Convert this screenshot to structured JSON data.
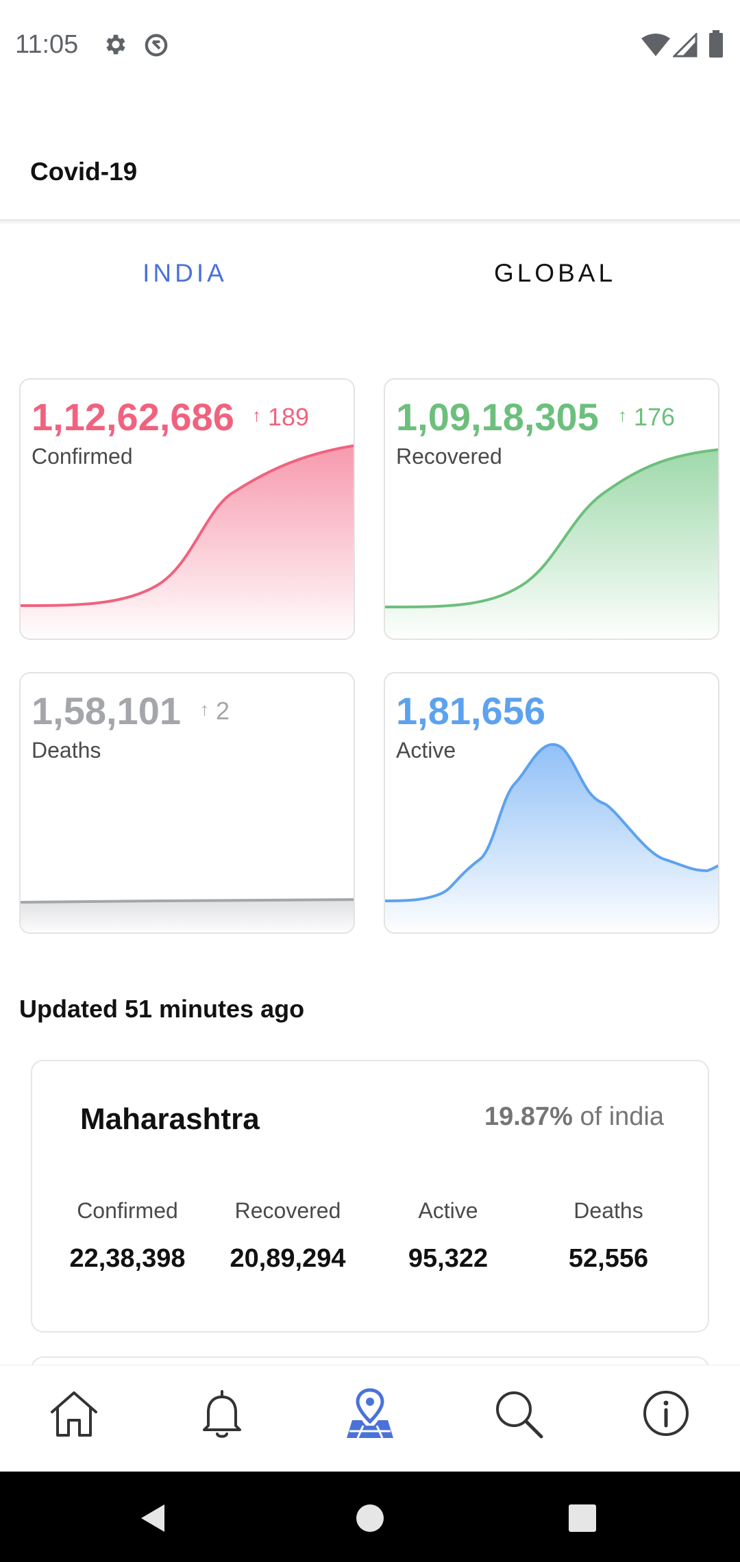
{
  "status_bar": {
    "time": "11:05",
    "icons": [
      "settings-icon",
      "sync-disabled-icon",
      "wifi-icon",
      "signal-icon",
      "battery-icon"
    ]
  },
  "app_bar": {
    "title": "Covid-19"
  },
  "tabs": [
    {
      "label": "INDIA",
      "active": true
    },
    {
      "label": "GLOBAL",
      "active": false
    }
  ],
  "colors": {
    "confirmed": "#f0627e",
    "recovered": "#6cbf7c",
    "deaths": "#a4a6ab",
    "active": "#5da2ee",
    "tab_active": "#4a72d8"
  },
  "stats": {
    "confirmed": {
      "value": "1,12,62,686",
      "delta": "189",
      "label": "Confirmed"
    },
    "recovered": {
      "value": "1,09,18,305",
      "delta": "176",
      "label": "Recovered"
    },
    "deaths": {
      "value": "1,58,101",
      "delta": "2",
      "label": "Deaths"
    },
    "active": {
      "value": "1,81,656",
      "label": "Active"
    }
  },
  "updated_text": "Updated 51 minutes ago",
  "state": {
    "name": "Maharashtra",
    "percent": "19.87%",
    "percent_suffix": " of india",
    "columns": [
      {
        "label": "Confirmed",
        "value": "22,38,398"
      },
      {
        "label": "Recovered",
        "value": "20,89,294"
      },
      {
        "label": "Active",
        "value": "95,322"
      },
      {
        "label": "Deaths",
        "value": "52,556"
      }
    ]
  },
  "bottom_nav": [
    {
      "icon": "home-icon",
      "active": false
    },
    {
      "icon": "bell-icon",
      "active": false
    },
    {
      "icon": "map-pin-icon",
      "active": true
    },
    {
      "icon": "search-icon",
      "active": false
    },
    {
      "icon": "info-icon",
      "active": false
    }
  ],
  "system_nav": [
    "back-icon",
    "home-circle-icon",
    "recents-icon"
  ]
}
